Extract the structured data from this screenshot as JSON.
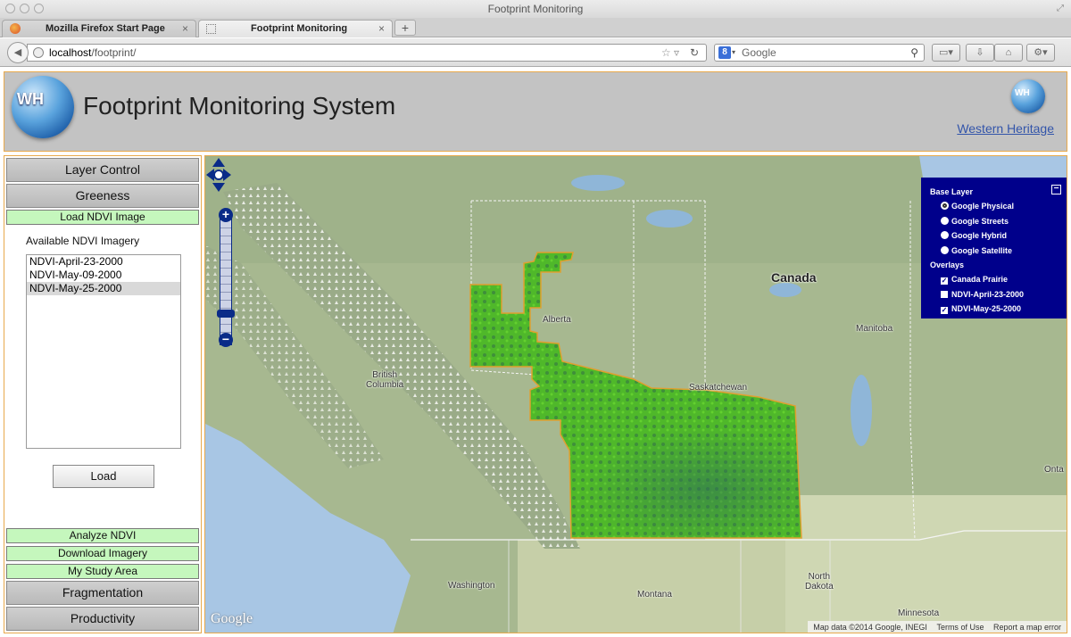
{
  "window": {
    "title": "Footprint Monitoring"
  },
  "tabs": [
    {
      "label": "Mozilla Firefox Start Page"
    },
    {
      "label": "Footprint Monitoring"
    }
  ],
  "address": {
    "host": "localhost",
    "path": "/footprint/"
  },
  "search": {
    "placeholder": "Google"
  },
  "header": {
    "logo_text": "WH",
    "title": "Footprint Monitoring System",
    "company_link": "Western Heritage"
  },
  "sidebar": {
    "layer_control": "Layer Control",
    "greeness": "Greeness",
    "load_ndvi": "Load NDVI Image",
    "available_label": "Available NDVI Imagery",
    "imagery": [
      "NDVI-April-23-2000",
      "NDVI-May-09-2000",
      "NDVI-May-25-2000"
    ],
    "selected_index": 2,
    "load_button": "Load",
    "analyze": "Analyze NDVI",
    "download": "Download Imagery",
    "study_area": "My Study Area",
    "fragmentation": "Fragmentation",
    "productivity": "Productivity"
  },
  "map": {
    "labels": {
      "canada": "Canada",
      "alberta": "Alberta",
      "bc_1": "British",
      "bc_2": "Columbia",
      "saskatchewan": "Saskatchewan",
      "manitoba": "Manitoba",
      "ontario": "Onta",
      "washington": "Washington",
      "montana": "Montana",
      "nd_1": "North",
      "nd_2": "Dakota",
      "minnesota": "Minnesota"
    },
    "google_logo": "Google",
    "attribution": {
      "data": "Map data ©2014 Google, INEGI",
      "terms": "Terms of Use",
      "report": "Report a map error"
    },
    "zoom_in": "+",
    "zoom_out": "−",
    "switcher": {
      "base_title": "Base Layer",
      "base_layers": [
        "Google Physical",
        "Google Streets",
        "Google Hybrid",
        "Google Satellite"
      ],
      "base_selected": 0,
      "overlays_title": "Overlays",
      "overlays": [
        {
          "label": "Canada Prairie",
          "checked": true
        },
        {
          "label": "NDVI-April-23-2000",
          "checked": false
        },
        {
          "label": "NDVI-May-25-2000",
          "checked": true
        }
      ],
      "minimize": "−"
    }
  },
  "colors": {
    "panel_border": "#e8a94c",
    "green_button": "#c5f7bd",
    "switcher_bg": "#00008b",
    "ndvi_fill": "#4fb82a"
  }
}
